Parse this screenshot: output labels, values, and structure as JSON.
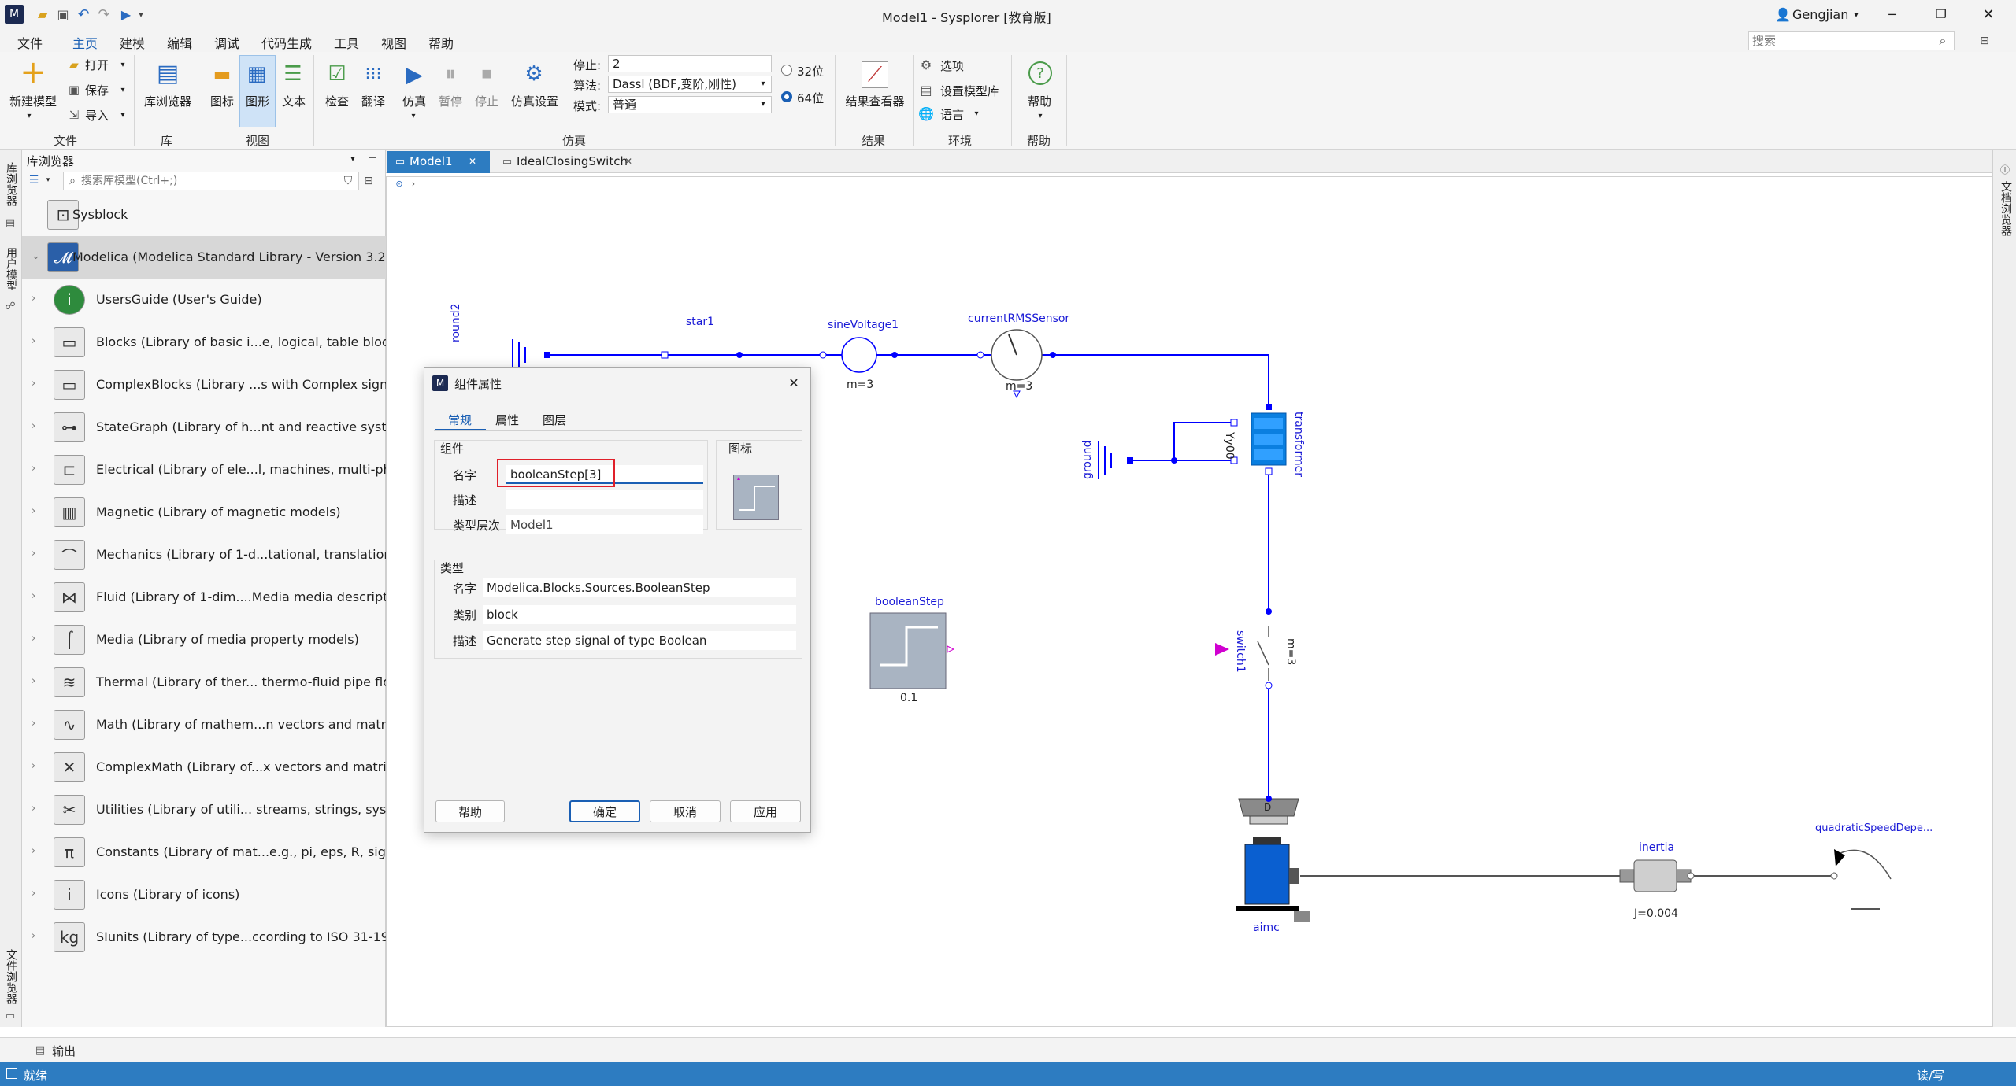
{
  "window": {
    "title": "Model1 - Sysplorer [教育版]",
    "user": "Gengjian"
  },
  "quick_access": [
    "folder-open-icon",
    "save-icon",
    "undo-icon",
    "redo-icon",
    "play-icon"
  ],
  "search": {
    "placeholder": "搜索"
  },
  "menu": [
    "文件",
    "主页",
    "建模",
    "编辑",
    "调试",
    "代码生成",
    "工具",
    "视图",
    "帮助"
  ],
  "ribbon": {
    "file": {
      "new_model": "新建模型",
      "open": "打开",
      "save": "保存",
      "import": "导入",
      "group": "文件"
    },
    "library": {
      "browser": "库浏览器",
      "group": "库"
    },
    "view": {
      "icon": "图标",
      "diagram": "图形",
      "text": "文本",
      "group": "视图"
    },
    "sim": {
      "check": "检查",
      "translate": "翻译",
      "simulate": "仿真",
      "pause": "暂停",
      "stop": "停止",
      "settings": "仿真设置",
      "stop_label": "停止:",
      "stop_value": "2",
      "algo_label": "算法:",
      "algo_value": "Dassl (BDF,变阶,刚性)",
      "mode_label": "模式:",
      "mode_value": "普通",
      "bit32": "32位",
      "bit64": "64位",
      "group": "仿真"
    },
    "results": {
      "viewer": "结果查看器",
      "group": "结果"
    },
    "env": {
      "options": "选项",
      "set_lib": "设置模型库",
      "language": "语言",
      "group": "环境"
    },
    "help": {
      "help": "帮助",
      "group": "帮助"
    }
  },
  "left_strip": {
    "lib_browser": "库浏览器",
    "user_model": "用户模型",
    "file_browser": "文件浏览器"
  },
  "library": {
    "title": "库浏览器",
    "search_placeholder": "搜索库模型(Ctrl+;)",
    "items": [
      {
        "label": "Sysblock",
        "icon": "sysblock-icon",
        "glyph": "⊡"
      },
      {
        "label": "Modelica (Modelica Standard Library - Version 3.2.3)",
        "icon": "modelica-icon",
        "glyph": "𝓜"
      },
      {
        "label": "UsersGuide (User's Guide)",
        "icon": "info-icon",
        "glyph": "i"
      },
      {
        "label": "Blocks (Library of basic i...e, logical, table blocks))",
        "icon": "blocks-icon",
        "glyph": "▭"
      },
      {
        "label": "ComplexBlocks (Library ...s with Complex signals)",
        "icon": "complexblocks-icon",
        "glyph": "▭"
      },
      {
        "label": "StateGraph (Library of h...nt and reactive systems)",
        "icon": "stategraph-icon",
        "glyph": "⊶"
      },
      {
        "label": "Electrical (Library of ele...l, machines, multi-phase))",
        "icon": "electrical-icon",
        "glyph": "⊏"
      },
      {
        "label": "Magnetic (Library of magnetic models)",
        "icon": "magnetic-icon",
        "glyph": "▥"
      },
      {
        "label": "Mechanics (Library of 1-d...tational, translational))",
        "icon": "mechanics-icon",
        "glyph": "⌒"
      },
      {
        "label": "Fluid (Library of 1-dim....Media media description)",
        "icon": "fluid-icon",
        "glyph": "⋈"
      },
      {
        "label": "Media (Library of media property models)",
        "icon": "media-icon",
        "glyph": "⌠"
      },
      {
        "label": "Thermal (Library of ther... thermo-fluid pipe flow)",
        "icon": "thermal-icon",
        "glyph": "≋"
      },
      {
        "label": "Math (Library of mathem...n vectors and matrices)",
        "icon": "math-icon",
        "glyph": "∿"
      },
      {
        "label": "ComplexMath (Library of...x vectors and matrices)",
        "icon": "complexmath-icon",
        "glyph": "✕"
      },
      {
        "label": "Utilities (Library of utili... streams, strings, system))",
        "icon": "utilities-icon",
        "glyph": "✂"
      },
      {
        "label": "Constants (Library of mat...e.g., pi, eps, R, sigma))",
        "icon": "constants-icon",
        "glyph": "π"
      },
      {
        "label": "Icons (Library of icons)",
        "icon": "icons-icon",
        "glyph": "i"
      },
      {
        "label": "SIunits (Library of type...ccording to ISO 31-1992)",
        "icon": "siunits-icon",
        "glyph": "kg"
      }
    ]
  },
  "tabs": [
    {
      "label": "Model1",
      "active": true
    },
    {
      "label": "IdealClosingSwitch",
      "active": false
    }
  ],
  "diagram": {
    "star": "star1",
    "ground_top": "round2",
    "sine": "sineVoltage1",
    "sine_m": "m=3",
    "rms": "currentRMSSensor",
    "rms_m": "m=3",
    "transformer": "transformer",
    "transformer_code": "Yy00",
    "ground": "ground",
    "booleanStep": "booleanStep",
    "booleanStep_val": "0.1",
    "switch": "switch1",
    "switch_m": "m=3",
    "terminal": "D",
    "aimc": "aimc",
    "inertia": "inertia",
    "inertia_J": "J=0.004",
    "load": "quadraticSpeedDepe..."
  },
  "dialog": {
    "title": "组件属性",
    "tabs": [
      "常规",
      "属性",
      "图层"
    ],
    "component_group": "组件",
    "icon_group": "图标",
    "name_label": "名字",
    "name_value": "booleanStep[3]",
    "desc_label": "描述",
    "desc_value": "",
    "level_label": "类型层次",
    "level_value": "Model1",
    "type_group": "类型",
    "type_name_label": "名字",
    "type_name_value": "Modelica.Blocks.Sources.BooleanStep",
    "type_class_label": "类别",
    "type_class_value": "block",
    "type_desc_label": "描述",
    "type_desc_value": "Generate step signal of type Boolean",
    "help": "帮助",
    "ok": "确定",
    "cancel": "取消",
    "apply": "应用"
  },
  "right_strip": {
    "doc_browser": "文档浏览器"
  },
  "output": {
    "label": "输出"
  },
  "status": {
    "left": "就绪",
    "right": "读/写"
  }
}
